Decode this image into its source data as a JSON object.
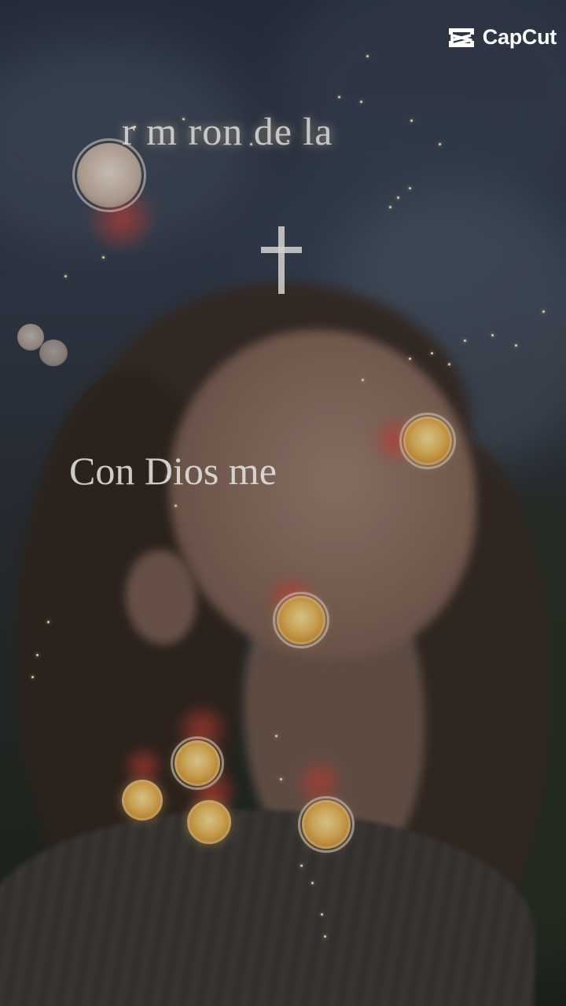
{
  "watermark": {
    "brand": "CapCut"
  },
  "overlay_text": {
    "top_title": "r m ron de la",
    "caption": "Con Dios me"
  },
  "icons": {
    "logo": "capcut-logo-icon",
    "cross": "cross-icon"
  },
  "colors": {
    "bokeh_warm": "#f3c261",
    "glow_red": "#dc463c",
    "text": "#e4e2e0"
  }
}
